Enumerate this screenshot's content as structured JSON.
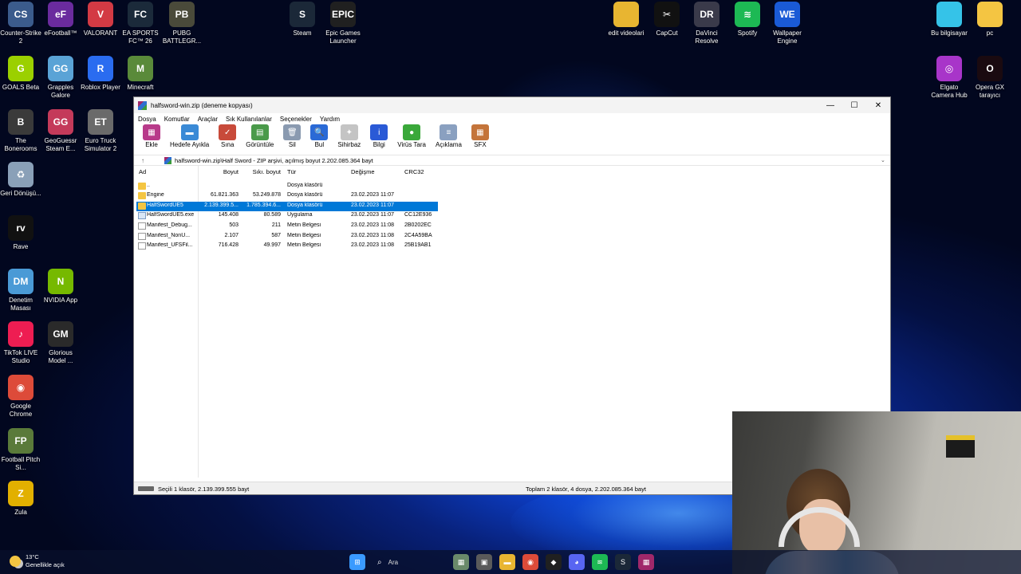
{
  "desktop_left": [
    {
      "label": "Counter-Strike 2",
      "icon": "counter-strike-icon",
      "color": "#3b5b8c",
      "glyph": "CS"
    },
    {
      "label": "eFootball™",
      "icon": "efootball-icon",
      "color": "#6a2b9e",
      "glyph": "eF"
    },
    {
      "label": "VALORANT",
      "icon": "valorant-icon",
      "color": "#d33a44",
      "glyph": "V"
    },
    {
      "label": "EA SPORTS FC™ 26",
      "icon": "ea-fc-icon",
      "color": "#1b2a3a",
      "glyph": "FC"
    },
    {
      "label": "PUBG BATTLEGR...",
      "icon": "pubg-icon",
      "color": "#4a4a3a",
      "glyph": "PB"
    },
    {
      "label": "GOALS Beta",
      "icon": "goals-icon",
      "color": "#9bd000",
      "glyph": "G"
    },
    {
      "label": "Grapples Galore",
      "icon": "grapples-icon",
      "color": "#5aa3d6",
      "glyph": "GG"
    },
    {
      "label": "Roblox Player",
      "icon": "roblox-icon",
      "color": "#2a6cf0",
      "glyph": "R"
    },
    {
      "label": "Minecraft",
      "icon": "minecraft-icon",
      "color": "#5a8a3a",
      "glyph": "M"
    },
    {
      "label": "The Bonerooms",
      "icon": "bonerooms-icon",
      "color": "#3a3a3a",
      "glyph": "B"
    },
    {
      "label": "GeoGuessr Steam E...",
      "icon": "geoguessr-icon",
      "color": "#c43a5a",
      "glyph": "GG"
    },
    {
      "label": "Euro Truck Simulator 2",
      "icon": "euro-truck-icon",
      "color": "#6a6a6a",
      "glyph": "ET"
    },
    {
      "label": "Geri Dönüşü...",
      "icon": "recycle-bin-icon",
      "color": "#8aa0b8",
      "glyph": "♻"
    },
    {
      "label": "Rave",
      "icon": "rave-icon",
      "color": "#111111",
      "glyph": "rv"
    },
    {
      "label": "Denetim Masası",
      "icon": "control-panel-icon",
      "color": "#4a9ad6",
      "glyph": "DM"
    },
    {
      "label": "NVIDIA App",
      "icon": "nvidia-icon",
      "color": "#76b900",
      "glyph": "N"
    },
    {
      "label": "TikTok LIVE Studio",
      "icon": "tiktok-icon",
      "color": "#ee1d52",
      "glyph": "♪"
    },
    {
      "label": "Glorious Model ...",
      "icon": "glorious-mouse-icon",
      "color": "#2a2a2a",
      "glyph": "GM"
    },
    {
      "label": "Google Chrome",
      "icon": "chrome-icon",
      "color": "#dd4b39",
      "glyph": "◉"
    },
    {
      "label": "Football Pitch Si...",
      "icon": "football-pitch-icon",
      "color": "#5a7a3a",
      "glyph": "FP"
    },
    {
      "label": "Zula",
      "icon": "zula-icon",
      "color": "#e2b000",
      "glyph": "Z"
    }
  ],
  "desktop_right": [
    {
      "label": "Steam",
      "icon": "steam-icon",
      "color": "#1b2838",
      "glyph": "S"
    },
    {
      "label": "Epic Games Launcher",
      "icon": "epic-games-icon",
      "color": "#202020",
      "glyph": "EPIC"
    },
    {
      "label": "edit videolari",
      "icon": "folder-icon",
      "color": "#e8b531",
      "glyph": ""
    },
    {
      "label": "CapCut",
      "icon": "capcut-icon",
      "color": "#111111",
      "glyph": "✂"
    },
    {
      "label": "DaVinci Resolve",
      "icon": "davinci-icon",
      "color": "#3a3a4a",
      "glyph": "DR"
    },
    {
      "label": "Spotify",
      "icon": "spotify-icon",
      "color": "#1db954",
      "glyph": "≋"
    },
    {
      "label": "Wallpaper Engine",
      "icon": "wallpaper-engine-icon",
      "color": "#1a5ad6",
      "glyph": "WE"
    },
    {
      "label": "Bu bilgisayar",
      "icon": "this-pc-icon",
      "color": "#35c3e8",
      "glyph": ""
    },
    {
      "label": "pc",
      "icon": "folder-icon",
      "color": "#f4c542",
      "glyph": ""
    },
    {
      "label": "Elgato Camera Hub",
      "icon": "elgato-icon",
      "color": "#a835c9",
      "glyph": "◎"
    },
    {
      "label": "Opera GX tarayıcı",
      "icon": "opera-gx-icon",
      "color": "#1a0a10",
      "glyph": "O"
    }
  ],
  "window": {
    "title": "halfsword-win.zip (deneme kopyası)",
    "menu": [
      "Dosya",
      "Komutlar",
      "Araçlar",
      "Sık Kullanılanlar",
      "Seçenekler",
      "Yardım"
    ],
    "toolbar": [
      {
        "label": "Ekle",
        "icon": "add-icon",
        "color": "#b83a8a",
        "glyph": "▦"
      },
      {
        "label": "Hedefe Ayıkla",
        "icon": "extract-to-icon",
        "color": "#3a8ad6",
        "glyph": "▬"
      },
      {
        "label": "Sına",
        "icon": "test-icon",
        "color": "#c84a3a",
        "glyph": "✓"
      },
      {
        "label": "Görüntüle",
        "icon": "view-icon",
        "color": "#4a9a4a",
        "glyph": "▤"
      },
      {
        "label": "Sil",
        "icon": "delete-icon",
        "color": "#8a9ab0",
        "glyph": "🗑"
      },
      {
        "label": "Bul",
        "icon": "find-icon",
        "color": "#2a6ad6",
        "glyph": "🔍"
      },
      {
        "label": "Sihirbaz",
        "icon": "wizard-icon",
        "color": "#c4c4c4",
        "glyph": "✦"
      },
      {
        "label": "Bilgi",
        "icon": "info-icon",
        "color": "#2a5ad6",
        "glyph": "i"
      },
      {
        "label": "Virüs Tara",
        "icon": "virus-scan-icon",
        "color": "#3aa83a",
        "glyph": "●"
      },
      {
        "label": "Açıklama",
        "icon": "comment-icon",
        "color": "#8aa0c0",
        "glyph": "≡"
      },
      {
        "label": "SFX",
        "icon": "sfx-icon",
        "color": "#c4743a",
        "glyph": "▦"
      }
    ],
    "path": "halfsword-win.zip\\Half Sword - ZIP arşivi, açılmış boyut 2.202.085.364 bayt",
    "columns": {
      "name": "Ad",
      "size": "Boyut",
      "packed": "Sıkı. boyut",
      "type": "Tür",
      "modified": "Değişme",
      "crc": "CRC32"
    },
    "files": [
      {
        "name": "..",
        "size": "",
        "packed": "",
        "type": "Dosya klasörü",
        "modified": "",
        "crc": "",
        "icon": "folder-icon",
        "selected": false
      },
      {
        "name": "Engine",
        "size": "61.821.363",
        "packed": "53.249.878",
        "type": "Dosya klasörü",
        "modified": "23.02.2023 11:07",
        "crc": "",
        "icon": "folder-icon",
        "selected": false
      },
      {
        "name": "HalfSwordUE5",
        "size": "2.139.399.5...",
        "packed": "1.785.394.6...",
        "type": "Dosya klasörü",
        "modified": "23.02.2023 11:07",
        "crc": "",
        "icon": "folder-icon",
        "selected": true
      },
      {
        "name": "HalfSwordUE5.exe",
        "size": "145.408",
        "packed": "80.589",
        "type": "Uygulama",
        "modified": "23.02.2023 11:07",
        "crc": "CC12E936",
        "icon": "exe-icon",
        "selected": false
      },
      {
        "name": "Manifest_Debug...",
        "size": "503",
        "packed": "211",
        "type": "Metin Belgesi",
        "modified": "23.02.2023 11:08",
        "crc": "2B0202EC",
        "icon": "document-icon",
        "selected": false
      },
      {
        "name": "Manifest_NonU...",
        "size": "2.107",
        "packed": "587",
        "type": "Metin Belgesi",
        "modified": "23.02.2023 11:08",
        "crc": "2C4A59BA",
        "icon": "document-icon",
        "selected": false
      },
      {
        "name": "Manifest_UFSFil...",
        "size": "716.428",
        "packed": "49.997",
        "type": "Metin Belgesi",
        "modified": "23.02.2023 11:08",
        "crc": "25B19AB1",
        "icon": "document-icon",
        "selected": false
      }
    ],
    "status_left": "Seçili 1 klasör, 2.139.399.555 bayt",
    "status_right": "Toplam 2 klasör, 4 dosya, 2.202.085.364 bayt"
  },
  "taskbar": {
    "temperature": "13°C",
    "weather": "Genellikle açık",
    "search_placeholder": "Ara",
    "icons": [
      {
        "name": "start-icon",
        "color": "#3a9aff",
        "glyph": "⊞"
      },
      {
        "name": "search-icon"
      },
      {
        "name": "widgets-icon",
        "color": "#6a8a6a",
        "glyph": "▦"
      },
      {
        "name": "task-view-icon",
        "color": "#5a5a5a",
        "glyph": "▣"
      },
      {
        "name": "file-explorer-icon",
        "color": "#e8b531",
        "glyph": "▬"
      },
      {
        "name": "chrome-icon",
        "color": "#dd4b39",
        "glyph": "◉"
      },
      {
        "name": "epic-games-icon",
        "color": "#202020",
        "glyph": "◆"
      },
      {
        "name": "discord-icon",
        "color": "#5865f2",
        "glyph": "◕"
      },
      {
        "name": "spotify-icon",
        "color": "#1db954",
        "glyph": "≋"
      },
      {
        "name": "steam-icon",
        "color": "#1b2838",
        "glyph": "S"
      },
      {
        "name": "winrar-icon",
        "color": "#a0286a",
        "glyph": "▦"
      }
    ]
  }
}
